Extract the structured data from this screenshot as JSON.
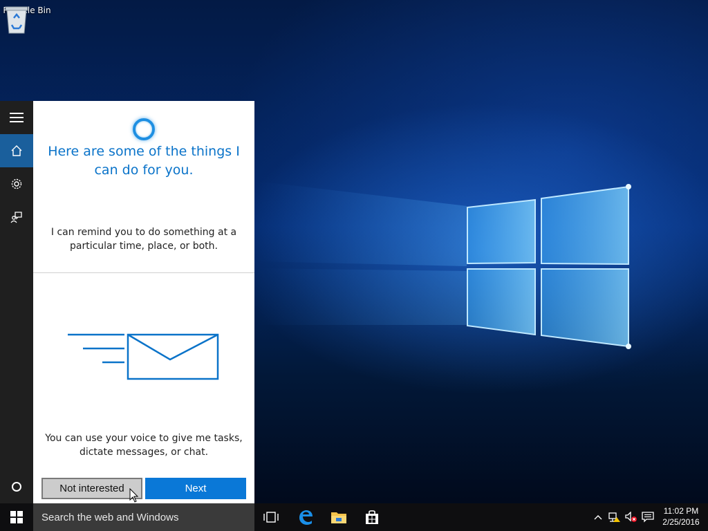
{
  "desktop": {
    "icons": [
      {
        "label": "Recycle Bin",
        "icon": "recycle-bin-icon"
      }
    ]
  },
  "cortana": {
    "rail": [
      {
        "name": "menu",
        "icon": "hamburger-menu-icon"
      },
      {
        "name": "home",
        "icon": "home-icon",
        "active": true
      },
      {
        "name": "settings",
        "icon": "gear-icon"
      },
      {
        "name": "feedback",
        "icon": "feedback-icon"
      },
      {
        "name": "cortana",
        "icon": "cortana-circle-icon"
      }
    ],
    "title": "Here are some of the things I can do for you.",
    "remind_text": "I can remind you to do something at a particular time, place, or both.",
    "illustration": "envelope-icon",
    "voice_text": "You can use your voice to give me tasks, dictate messages, or chat.",
    "buttons": {
      "not_interested": "Not interested",
      "next": "Next"
    }
  },
  "taskbar": {
    "search_placeholder": "Search the web and Windows",
    "pinned": [
      {
        "name": "task-view",
        "icon": "task-view-icon"
      },
      {
        "name": "edge",
        "icon": "edge-icon"
      },
      {
        "name": "file-explorer",
        "icon": "folder-icon"
      },
      {
        "name": "store",
        "icon": "store-icon"
      }
    ],
    "tray": [
      {
        "name": "show-hidden",
        "icon": "chevron-up-icon"
      },
      {
        "name": "network",
        "icon": "network-icon"
      },
      {
        "name": "volume",
        "icon": "volume-muted-icon"
      },
      {
        "name": "action-center",
        "icon": "action-center-icon"
      }
    ],
    "clock": {
      "time": "11:02 PM",
      "date": "2/25/2016"
    }
  },
  "colors": {
    "accent": "#0a78d7",
    "title_blue": "#0a73c9",
    "rail_active": "#1a5f9c"
  }
}
